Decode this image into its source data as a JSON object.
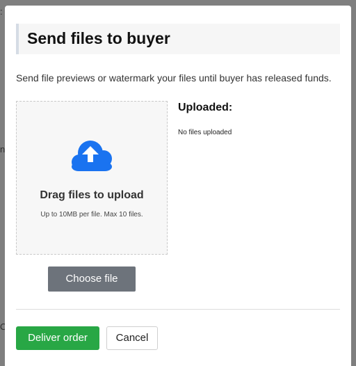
{
  "modal": {
    "title": "Send files to buyer",
    "subtitle": "Send file previews or watermark your files until buyer has released funds.",
    "dropzone": {
      "icon": "cloud-upload-icon",
      "title": "Drag files to upload",
      "hint": "Up to 10MB per file. Max 10 files."
    },
    "choose_file_label": "Choose file",
    "uploaded": {
      "heading": "Uploaded:",
      "empty_text": "No files uploaded"
    },
    "footer": {
      "deliver_label": "Deliver order",
      "cancel_label": "Cancel"
    }
  },
  "backdrop": {
    "fragments": [
      ":",
      "na",
      "O"
    ]
  },
  "colors": {
    "accent_blue": "#1a73f0",
    "deliver_green": "#28a745",
    "choose_gray": "#6d737b"
  }
}
